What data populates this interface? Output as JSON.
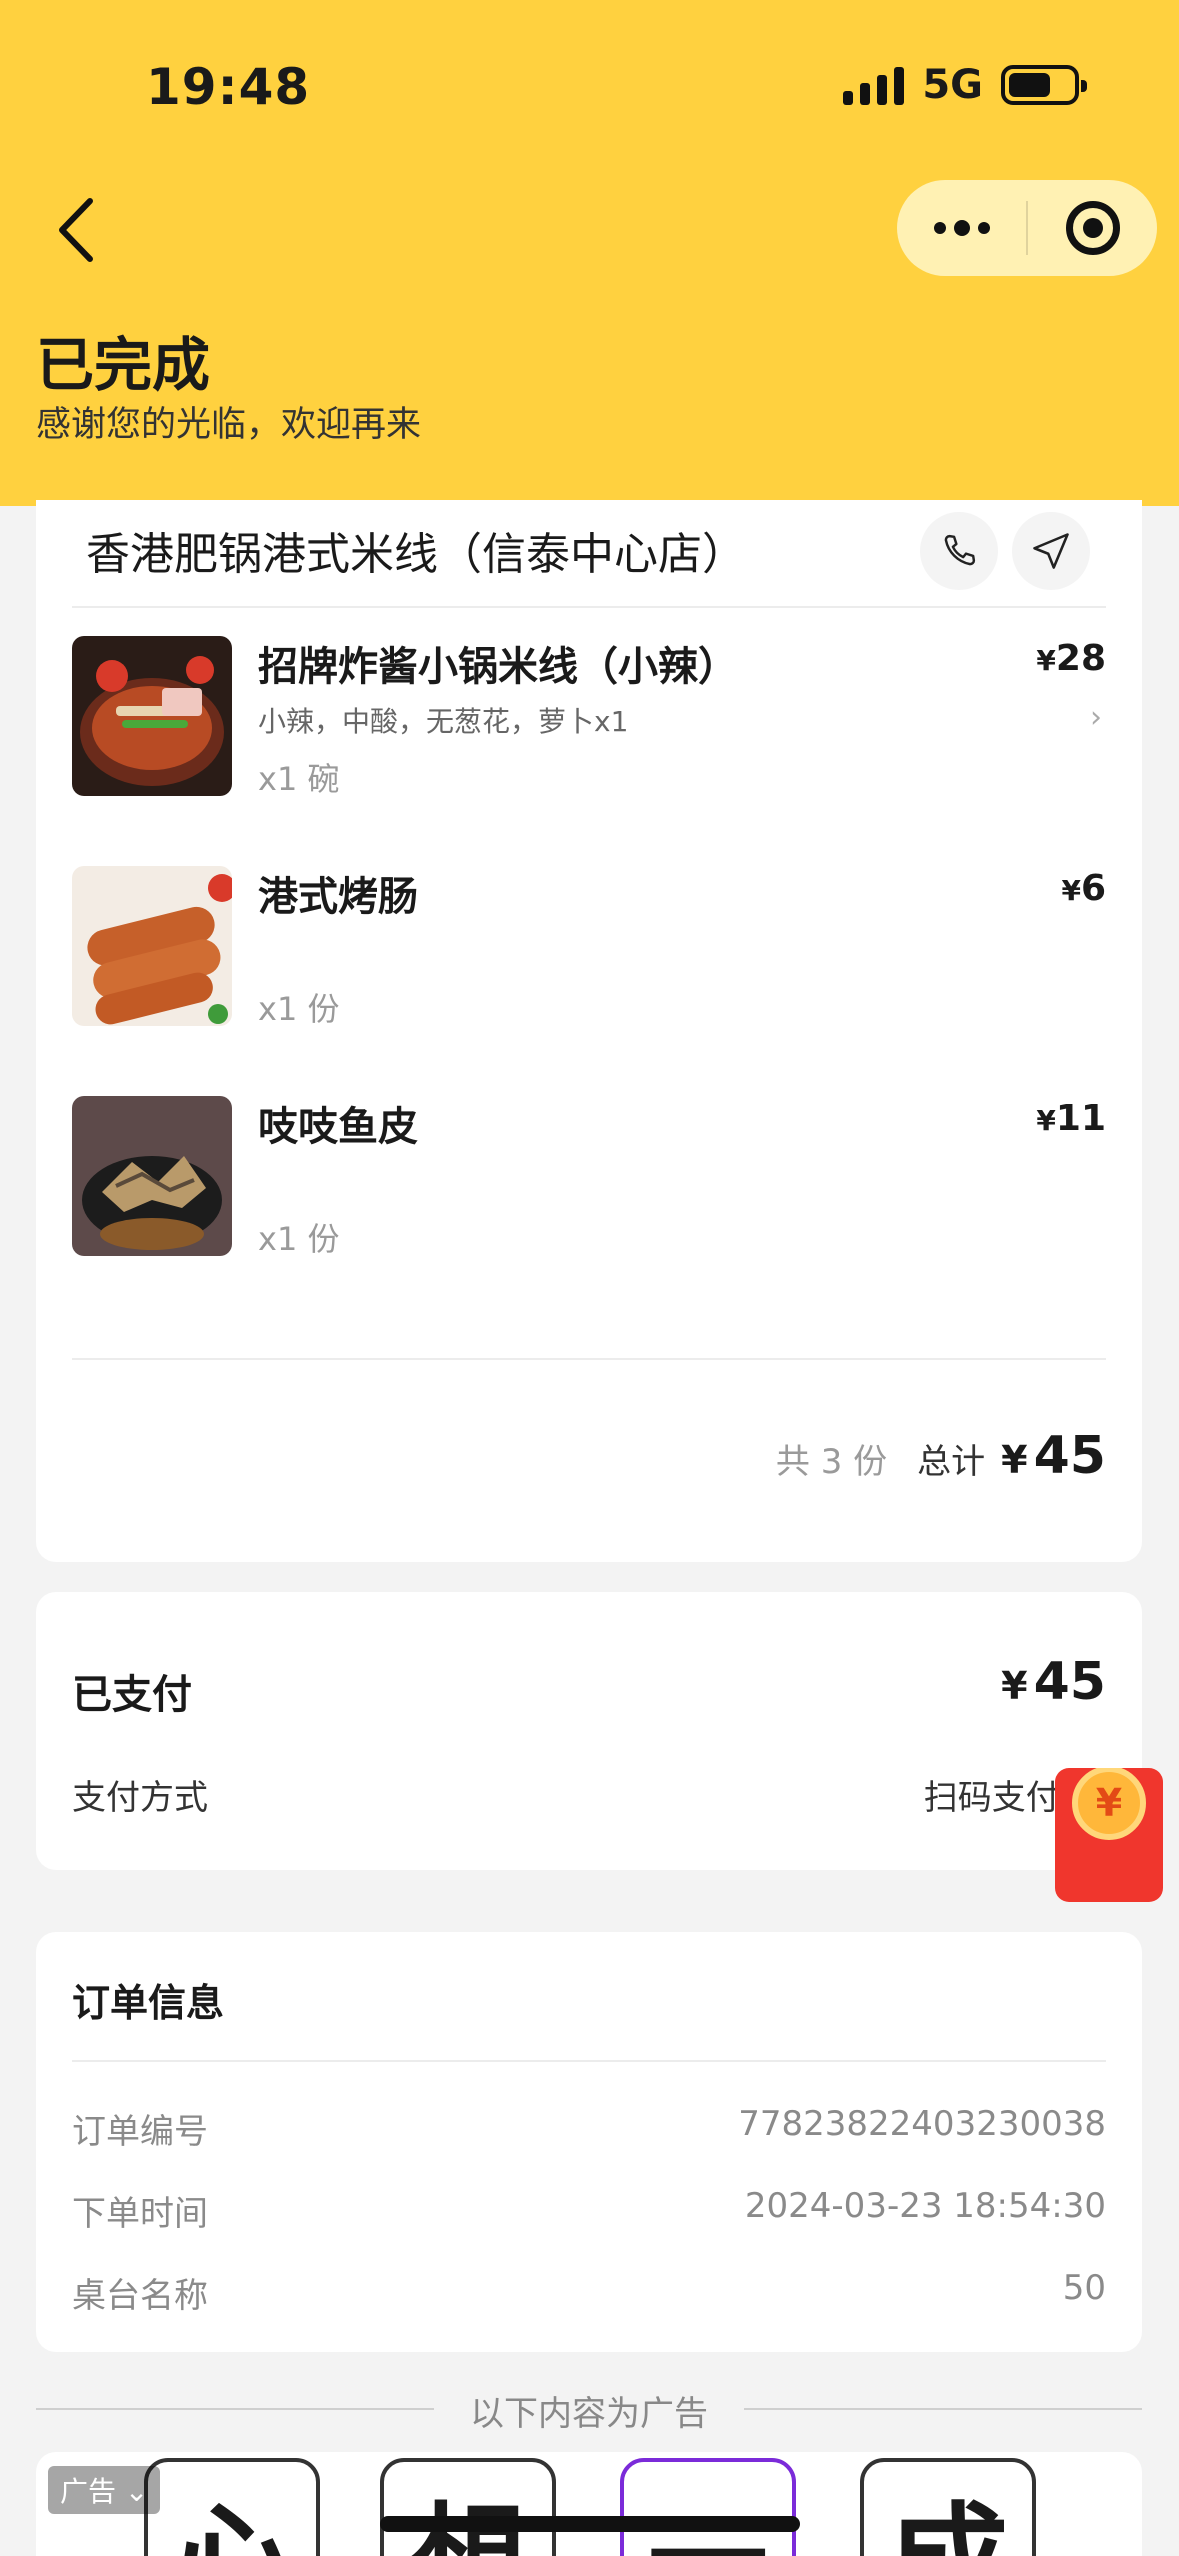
{
  "status_bar": {
    "time": "19:48",
    "network": "5G"
  },
  "header": {
    "title": "已完成",
    "subtitle": "感谢您的光临，欢迎再来"
  },
  "store": {
    "name": "香港肥锅港式米线（信泰中心店）",
    "items": [
      {
        "name": "招牌炸酱小锅米线（小辣）",
        "spec": "小辣，中酸，无葱花，萝卜x1",
        "qty": "x1 碗",
        "price": "28",
        "has_detail": true
      },
      {
        "name": "港式烤肠",
        "spec": "",
        "qty": "x1 份",
        "price": "6",
        "has_detail": false
      },
      {
        "name": "吱吱鱼皮",
        "spec": "",
        "qty": "x1 份",
        "price": "11",
        "has_detail": false
      }
    ],
    "summary": {
      "count_text": "共 3 份",
      "total_label": "总计",
      "currency": "¥",
      "total": "45"
    }
  },
  "payment": {
    "title": "已支付",
    "currency": "¥",
    "amount": "45",
    "method_label": "支付方式",
    "method_value": "扫码支付-微"
  },
  "order_info": {
    "title": "订单信息",
    "rows": [
      {
        "label": "订单编号",
        "value": "77823822403230038"
      },
      {
        "label": "下单时间",
        "value": "2024-03-23 18:54:30"
      },
      {
        "label": "桌台名称",
        "value": "50"
      }
    ]
  },
  "ads": {
    "separator_text": "以下内容为广告",
    "badge": "广告",
    "tiles": [
      "心",
      "想",
      "一",
      "成"
    ]
  },
  "colors": {
    "header_bg": "#ffd13f",
    "page_bg": "#f3f3f3",
    "redpacket": "#f0362d",
    "ad_tile_highlight": "#7b2bd9"
  },
  "icons": [
    "back-arrow-icon",
    "more-dots-icon",
    "target-icon",
    "phone-icon",
    "navigate-icon",
    "chevron-right-icon",
    "red-packet-icon",
    "chevron-down-icon"
  ]
}
